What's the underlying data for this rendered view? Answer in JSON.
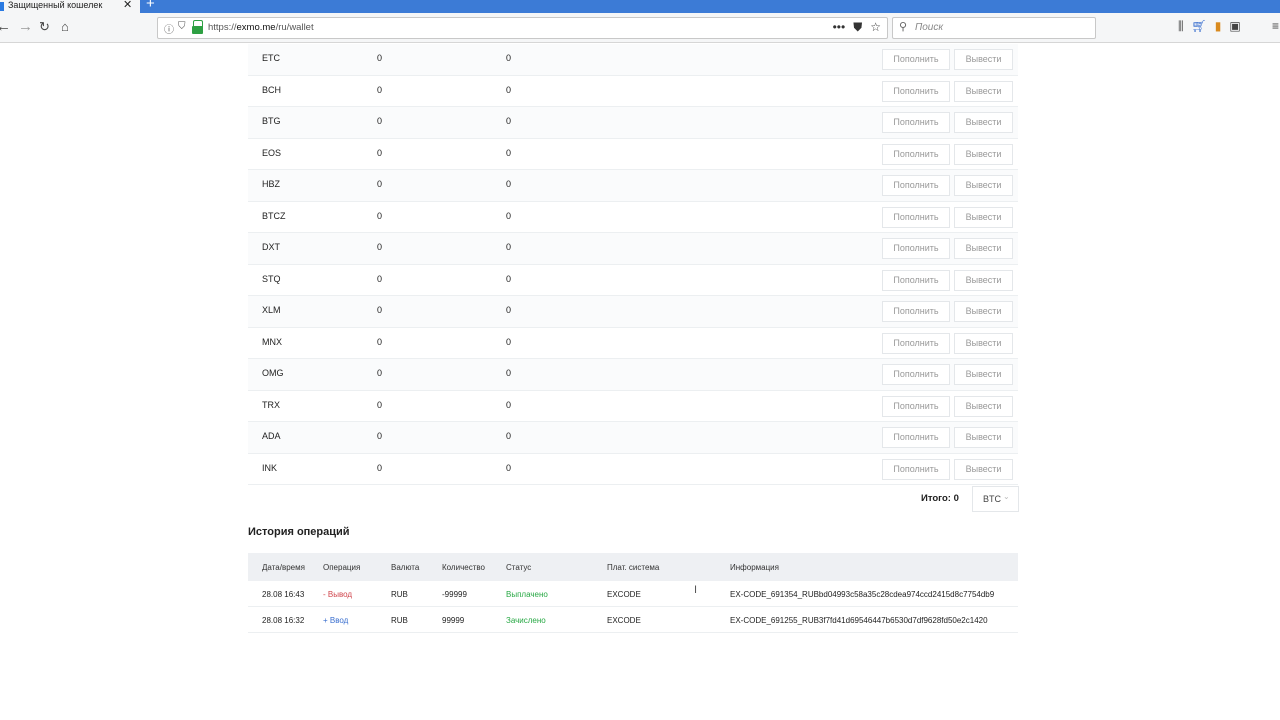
{
  "browser": {
    "tab_title": "Защищенный кошелек",
    "tab_close": "✕",
    "new_tab": "+",
    "url_prefix": "https://",
    "url_host": "exmo.me",
    "url_path": "/ru/wallet",
    "search_placeholder": "Поиск"
  },
  "wallet": {
    "deposit_label": "Пополнить",
    "withdraw_label": "Вывести",
    "rows": [
      {
        "currency": "ETC",
        "balance": "0",
        "reserved": "0"
      },
      {
        "currency": "BCH",
        "balance": "0",
        "reserved": "0"
      },
      {
        "currency": "BTG",
        "balance": "0",
        "reserved": "0"
      },
      {
        "currency": "EOS",
        "balance": "0",
        "reserved": "0"
      },
      {
        "currency": "HBZ",
        "balance": "0",
        "reserved": "0"
      },
      {
        "currency": "BTCZ",
        "balance": "0",
        "reserved": "0"
      },
      {
        "currency": "DXT",
        "balance": "0",
        "reserved": "0"
      },
      {
        "currency": "STQ",
        "balance": "0",
        "reserved": "0"
      },
      {
        "currency": "XLM",
        "balance": "0",
        "reserved": "0"
      },
      {
        "currency": "MNX",
        "balance": "0",
        "reserved": "0"
      },
      {
        "currency": "OMG",
        "balance": "0",
        "reserved": "0"
      },
      {
        "currency": "TRX",
        "balance": "0",
        "reserved": "0"
      },
      {
        "currency": "ADA",
        "balance": "0",
        "reserved": "0"
      },
      {
        "currency": "INK",
        "balance": "0",
        "reserved": "0"
      }
    ],
    "total_label": "Итого: 0",
    "total_currency": "BTC"
  },
  "history": {
    "title": "История операций",
    "columns": [
      "Дата/время",
      "Операция",
      "Валюта",
      "Количество",
      "Статус",
      "Плат. система",
      "Информация"
    ],
    "rows": [
      {
        "datetime": "28.08 16:43",
        "operation": "- Вывод",
        "currency": "RUB",
        "amount": "-99999",
        "status": "Выплачено",
        "system": "EXCODE",
        "info": "EX-CODE_691354_RUBbd04993c58a35c28cdea974ccd2415d8c7754db9"
      },
      {
        "datetime": "28.08 16:32",
        "operation": "+ Ввод",
        "currency": "RUB",
        "amount": "99999",
        "status": "Зачислено",
        "system": "EXCODE",
        "info": "EX-CODE_691255_RUB3f7fd41d69546447b6530d7df9628fd50e2c1420"
      }
    ]
  },
  "colors": {
    "withdraw_operation": "#d0454c",
    "deposit_operation": "#3a6fcf",
    "status_success": "#27a844"
  }
}
